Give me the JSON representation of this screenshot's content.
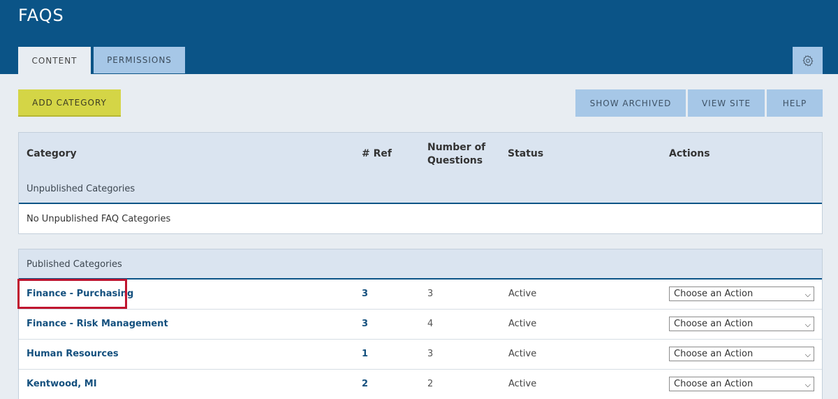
{
  "header": {
    "title": "FAQS",
    "tabs": [
      {
        "label": "CONTENT",
        "active": true
      },
      {
        "label": "PERMISSIONS",
        "active": false
      }
    ]
  },
  "toolbar": {
    "add_category": "ADD CATEGORY",
    "show_archived": "SHOW ARCHIVED",
    "view_site": "VIEW SITE",
    "help": "HELP"
  },
  "table": {
    "headers": {
      "category": "Category",
      "ref": "# Ref",
      "num_questions": "Number of Questions",
      "status": "Status",
      "actions": "Actions"
    },
    "unpublished": {
      "label": "Unpublished Categories",
      "empty_text": "No Unpublished FAQ Categories"
    },
    "published": {
      "label": "Published Categories",
      "rows": [
        {
          "name": "Finance - Purchasing",
          "ref": "3",
          "questions": "3",
          "status": "Active",
          "action": "Choose an Action"
        },
        {
          "name": "Finance - Risk Management",
          "ref": "3",
          "questions": "4",
          "status": "Active",
          "action": "Choose an Action"
        },
        {
          "name": "Human Resources",
          "ref": "1",
          "questions": "3",
          "status": "Active",
          "action": "Choose an Action"
        },
        {
          "name": "Kentwood, MI",
          "ref": "2",
          "questions": "2",
          "status": "Active",
          "action": "Choose an Action"
        }
      ]
    }
  },
  "icons": {
    "settings": "gear-icon",
    "dropdown": "chevron-down-icon"
  },
  "colors": {
    "header": "#0b5487",
    "accent_button": "#d4d546",
    "highlight": "#c0142f"
  }
}
